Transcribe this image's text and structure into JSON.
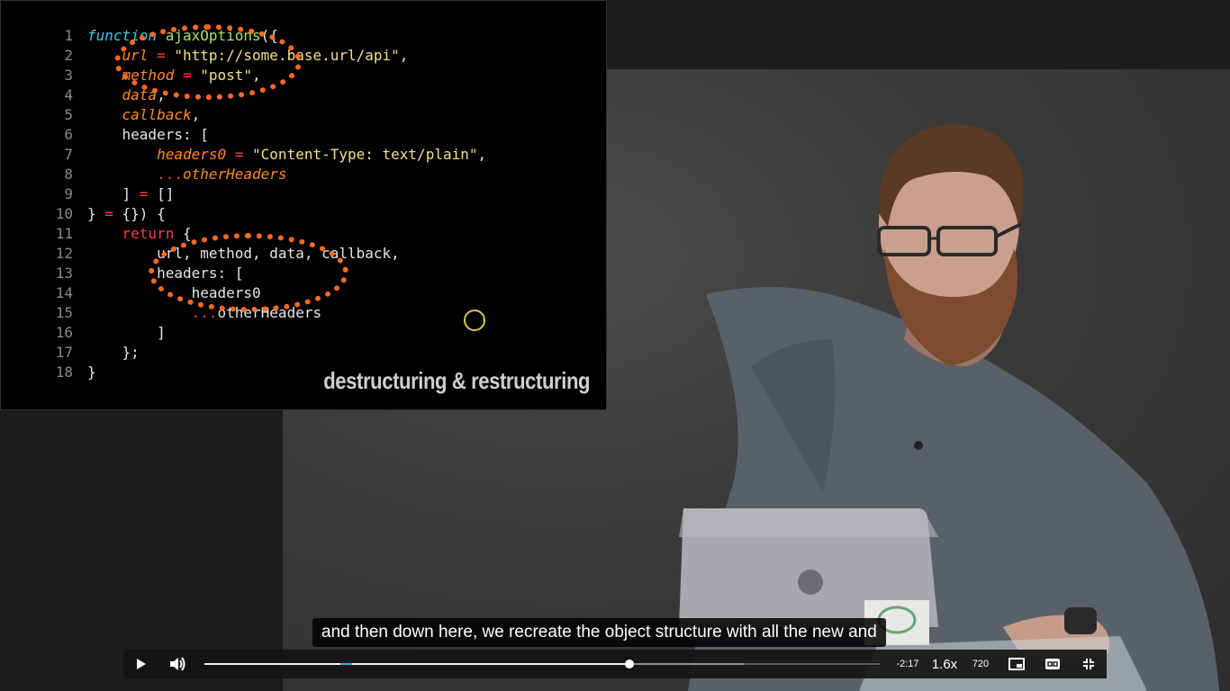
{
  "slide": {
    "code_lines": [
      {
        "num": "1",
        "tokens": [
          {
            "t": "function",
            "c": "kw"
          },
          {
            "t": " "
          },
          {
            "t": "ajaxOptions",
            "c": "fn"
          },
          {
            "t": "({"
          }
        ]
      },
      {
        "num": "2",
        "tokens": [
          {
            "t": "    "
          },
          {
            "t": "url",
            "c": "prm"
          },
          {
            "t": " = ",
            "c": "op"
          },
          {
            "t": "\"http://some.base.url/api\"",
            "c": "str"
          },
          {
            "t": ","
          }
        ]
      },
      {
        "num": "3",
        "tokens": [
          {
            "t": "    "
          },
          {
            "t": "method",
            "c": "prm"
          },
          {
            "t": " = ",
            "c": "op"
          },
          {
            "t": "\"post\"",
            "c": "str"
          },
          {
            "t": ","
          }
        ]
      },
      {
        "num": "4",
        "tokens": [
          {
            "t": "    "
          },
          {
            "t": "data",
            "c": "prm"
          },
          {
            "t": ","
          }
        ]
      },
      {
        "num": "5",
        "tokens": [
          {
            "t": "    "
          },
          {
            "t": "callback",
            "c": "prm"
          },
          {
            "t": ","
          }
        ]
      },
      {
        "num": "6",
        "tokens": [
          {
            "t": "    headers: ["
          }
        ]
      },
      {
        "num": "7",
        "tokens": [
          {
            "t": "        "
          },
          {
            "t": "headers0",
            "c": "prm"
          },
          {
            "t": " = ",
            "c": "op"
          },
          {
            "t": "\"Content-Type: text/plain\"",
            "c": "str"
          },
          {
            "t": ","
          }
        ]
      },
      {
        "num": "8",
        "tokens": [
          {
            "t": "        "
          },
          {
            "t": "...",
            "c": "op"
          },
          {
            "t": "otherHeaders",
            "c": "prm"
          }
        ]
      },
      {
        "num": "9",
        "tokens": [
          {
            "t": "    ] "
          },
          {
            "t": "=",
            "c": "op"
          },
          {
            "t": " []"
          }
        ]
      },
      {
        "num": "10",
        "tokens": [
          {
            "t": "} "
          },
          {
            "t": "=",
            "c": "op"
          },
          {
            "t": " {}) {"
          }
        ]
      },
      {
        "num": "11",
        "tokens": [
          {
            "t": "    "
          },
          {
            "t": "return",
            "c": "ret"
          },
          {
            "t": " {"
          }
        ]
      },
      {
        "num": "12",
        "tokens": [
          {
            "t": "        url, method, data, callback,"
          }
        ]
      },
      {
        "num": "13",
        "tokens": [
          {
            "t": "        headers: ["
          }
        ]
      },
      {
        "num": "14",
        "tokens": [
          {
            "t": "            headers0"
          }
        ]
      },
      {
        "num": "15",
        "tokens": [
          {
            "t": "            "
          },
          {
            "t": "...",
            "c": "op"
          },
          {
            "t": "otherHeaders"
          }
        ]
      },
      {
        "num": "16",
        "tokens": [
          {
            "t": "        ]"
          }
        ]
      },
      {
        "num": "17",
        "tokens": [
          {
            "t": "    };"
          }
        ]
      },
      {
        "num": "18",
        "tokens": [
          {
            "t": "}"
          }
        ]
      }
    ],
    "caption": "destructuring & restructuring"
  },
  "subtitle": "and then down here, we recreate the object structure with all the new and",
  "player": {
    "time_remaining": "-2:17",
    "speed": "1.6x",
    "quality": "720",
    "progress_fraction": 0.6293,
    "buffered_fraction": 0.7987,
    "chunk_start_fraction": 0.2013,
    "chunk_end_fraction": 0.2187,
    "icons": {
      "play": "play-icon",
      "volume": "volume-icon",
      "pip": "picture-in-picture-icon",
      "captions": "captions-icon",
      "exit_fullscreen": "exit-fullscreen-icon"
    }
  },
  "colors": {
    "keyword": "#40c8e8",
    "function_name": "#a8e26a",
    "parameter": "#ff8a24",
    "string": "#f0e08a",
    "operator": "#ff3a50",
    "annotation": "#ff6a1f",
    "accent_chunk": "#29b3d6"
  }
}
